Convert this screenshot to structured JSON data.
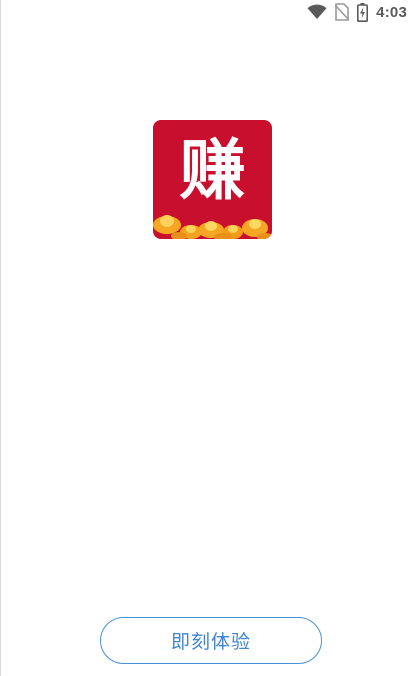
{
  "status_bar": {
    "time": "4:03",
    "icons": [
      "wifi-icon",
      "no-sim-icon",
      "battery-charging-icon"
    ]
  },
  "app": {
    "icon_glyph": "赚",
    "icon_background": "#c8102e",
    "icon_accent": "#f5a623"
  },
  "actions": {
    "primary_label": "即刻体验",
    "primary_color": "#4a90d9"
  }
}
